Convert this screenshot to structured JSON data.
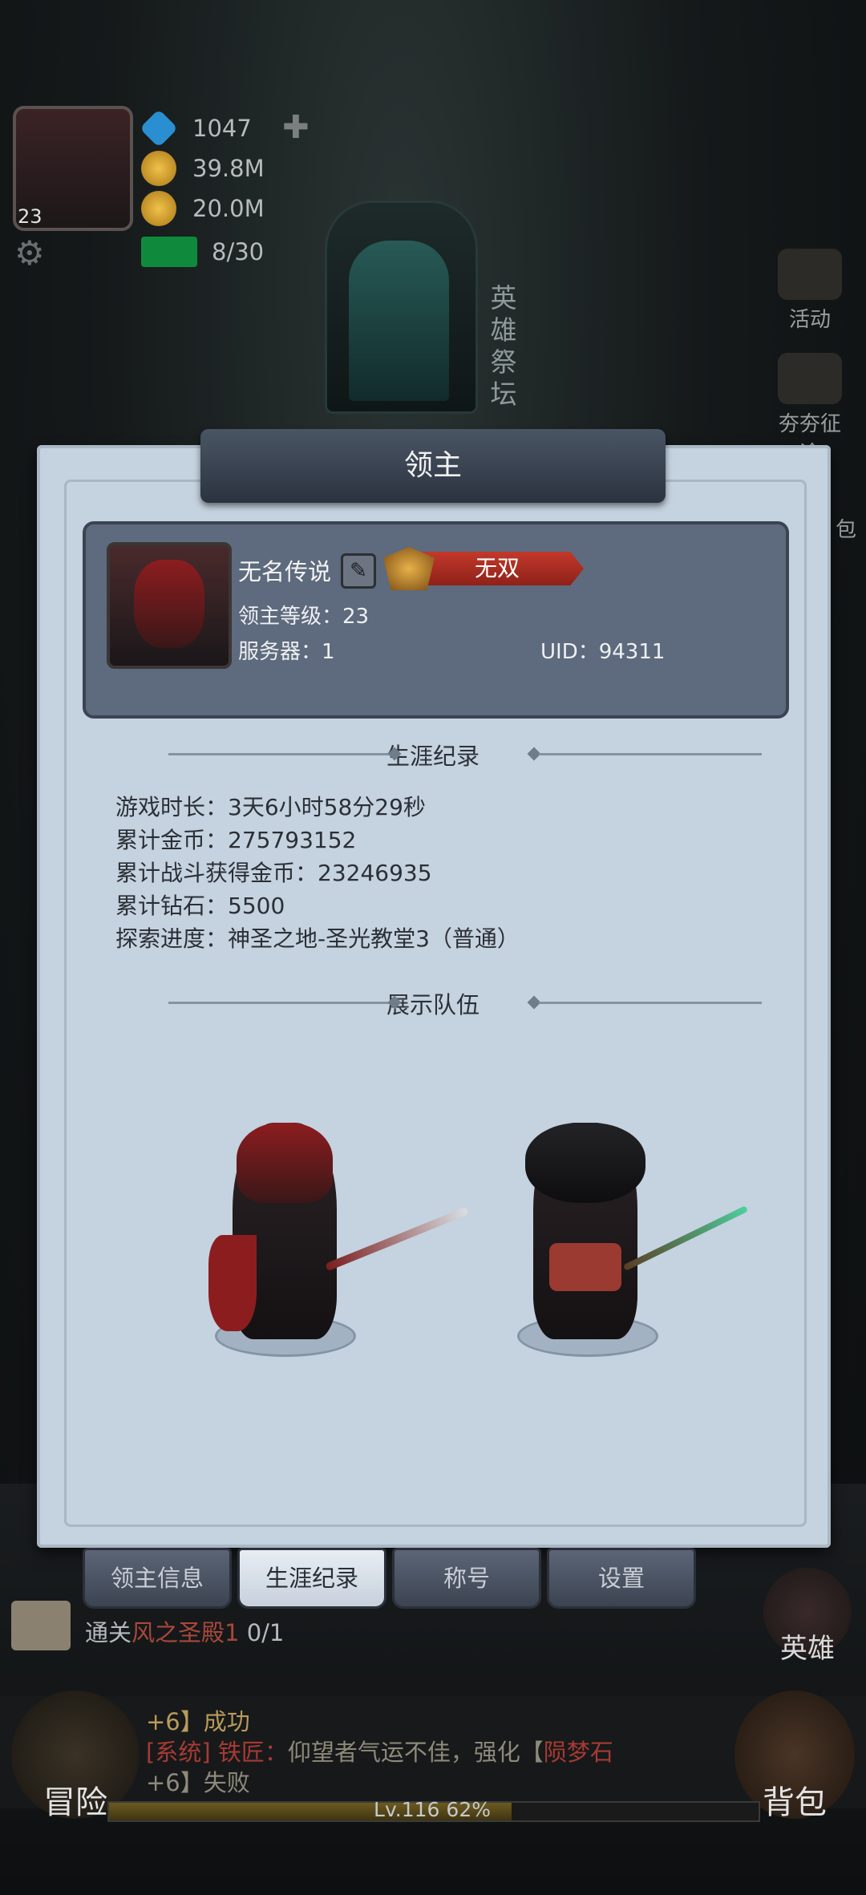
{
  "hud": {
    "player_level": "23",
    "diamonds": "1047",
    "gold": "39.8M",
    "coins": "20.0M",
    "stamina": "8/30"
  },
  "altar_label": "英雄祭坛",
  "side_icons": [
    "活动",
    "夯夯征途",
    "包"
  ],
  "panel": {
    "title": "领主",
    "profile": {
      "name": "无名传说",
      "title_badge": "无双",
      "level_line": "领主等级：23",
      "server_line": "服务器：1",
      "uid_line": "UID：94311"
    },
    "career_heading": "生涯纪录",
    "stats": [
      "游戏时长：3天6小时58分29秒",
      "累计金币：275793152",
      "累计战斗获得金币：23246935",
      "累计钻石：5500",
      "探索进度：神圣之地-圣光教堂3（普通）"
    ],
    "team_heading": "展示队伍"
  },
  "tabs": [
    {
      "label": "领主信息",
      "active": false
    },
    {
      "label": "生涯纪录",
      "active": true
    },
    {
      "label": "称号",
      "active": false
    },
    {
      "label": "设置",
      "active": false
    }
  ],
  "quest": {
    "prefix": "通关",
    "target": "风之圣殿1",
    "progress": "0/1"
  },
  "buttons": {
    "hero": "英雄",
    "adventure": "冒险",
    "bag": "背包"
  },
  "log": {
    "line1": "+6】成功",
    "line2_tag": "[系统]",
    "line2_name": "铁匠：",
    "line2_text": "仰望者气运不佳，强化【",
    "line2_item": "陨梦石",
    "line3": "+6】失败"
  },
  "xp": {
    "label": "Lv.116   62%",
    "percent": 62
  },
  "colors": {
    "accent_red": "#c2392a",
    "panel": "#c5d2df",
    "card": "#5e6a7d"
  }
}
